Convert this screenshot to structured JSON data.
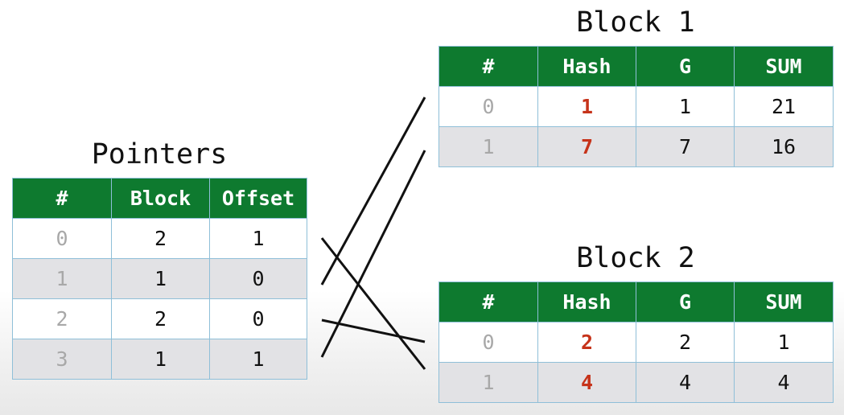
{
  "pointers": {
    "title": "Pointers",
    "headers": [
      "#",
      "Block",
      "Offset"
    ],
    "rows": [
      {
        "index": "0",
        "block": "2",
        "offset": "1"
      },
      {
        "index": "1",
        "block": "1",
        "offset": "0"
      },
      {
        "index": "2",
        "block": "2",
        "offset": "0"
      },
      {
        "index": "3",
        "block": "1",
        "offset": "1"
      }
    ]
  },
  "block1": {
    "title": "Block 1",
    "headers": [
      "#",
      "Hash",
      "G",
      "SUM"
    ],
    "rows": [
      {
        "index": "0",
        "hash": "1",
        "g": "1",
        "sum": "21"
      },
      {
        "index": "1",
        "hash": "7",
        "g": "7",
        "sum": "16"
      }
    ]
  },
  "block2": {
    "title": "Block 2",
    "headers": [
      "#",
      "Hash",
      "G",
      "SUM"
    ],
    "rows": [
      {
        "index": "0",
        "hash": "2",
        "g": "2",
        "sum": "1"
      },
      {
        "index": "1",
        "hash": "4",
        "g": "4",
        "sum": "4"
      }
    ]
  },
  "colors": {
    "header_bg": "#0e7a2f",
    "hash_text": "#c6331a",
    "row_alt_bg": "#e2e2e5",
    "index_text": "#a8a8a8"
  }
}
